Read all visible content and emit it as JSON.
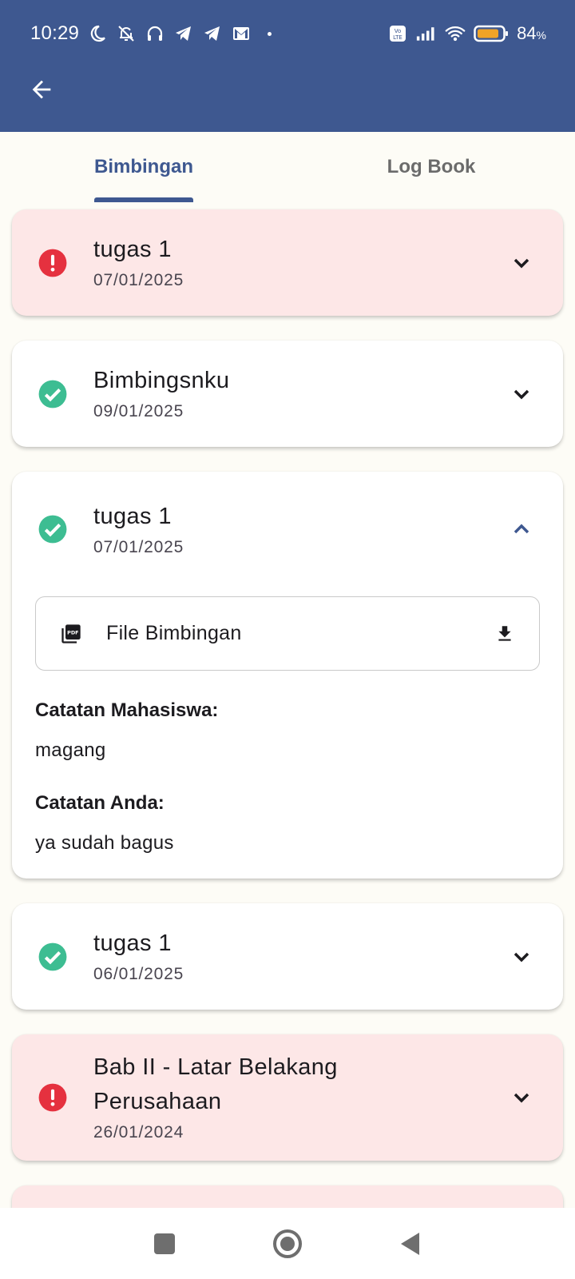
{
  "status_bar": {
    "time": "10:29",
    "battery_percent": "84",
    "battery_unit": "%",
    "icons": [
      "moon-icon",
      "bell-off-icon",
      "headset-icon",
      "telegram-icon",
      "telegram-icon",
      "gmail-icon",
      "volte-icon",
      "signal-icon",
      "wifi-icon",
      "battery-icon"
    ]
  },
  "app_bar": {
    "back_icon": "arrow-left-icon",
    "color": "#3e5890"
  },
  "tabs": [
    {
      "label": "Bimbingan",
      "active": true
    },
    {
      "label": "Log Book",
      "active": false
    }
  ],
  "items": [
    {
      "title": "tugas 1",
      "date": "07/01/2025",
      "status": "warning",
      "expanded": false
    },
    {
      "title": "Bimbingsnku",
      "date": "09/01/2025",
      "status": "approved",
      "expanded": false
    },
    {
      "title": "tugas 1",
      "date": "07/01/2025",
      "status": "approved",
      "expanded": true,
      "file_label": "File Bimbingan",
      "student_note_label": "Catatan Mahasiswa:",
      "student_note": "magang",
      "your_note_label": "Catatan Anda:",
      "your_note": "ya sudah bagus"
    },
    {
      "title": "tugas 1",
      "date": "06/01/2025",
      "status": "approved",
      "expanded": false
    },
    {
      "title": "Bab II - Latar Belakang Perusahaan",
      "date": "26/01/2024",
      "status": "warning",
      "expanded": false
    }
  ],
  "colors": {
    "primary": "#3e5890",
    "warning_bg": "#fde7e7",
    "warning_icon": "#e5313f",
    "success_icon": "#3dbd92",
    "page_bg": "#fdfcf6"
  },
  "nav_bar": {
    "buttons": [
      "recents-square-icon",
      "home-circle-icon",
      "back-triangle-icon"
    ]
  }
}
